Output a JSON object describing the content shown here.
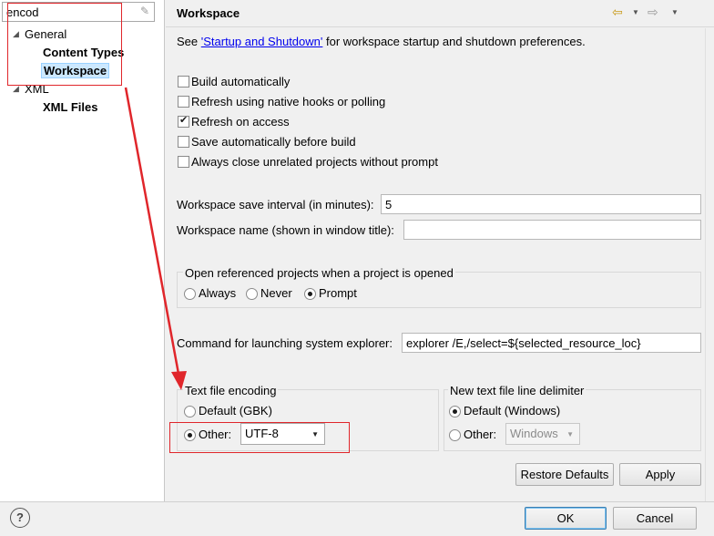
{
  "left_pane": {
    "filter_value": "encod",
    "clear_icon": "eraser-icon",
    "tree": [
      {
        "label": "General",
        "expanded": true,
        "arrow": "◢"
      },
      {
        "label": "Content Types"
      },
      {
        "label": "Workspace",
        "selected": true
      },
      {
        "label": "XML",
        "expanded": true,
        "arrow": "◢"
      },
      {
        "label": "XML Files"
      }
    ]
  },
  "header": {
    "title": "Workspace",
    "back_icon": "⇦",
    "menu_icon": "▼",
    "forward_icon": "⇨"
  },
  "intro": {
    "prefix": "See ",
    "link": "'Startup and Shutdown'",
    "suffix": " for workspace startup and shutdown preferences."
  },
  "checkboxes": [
    {
      "label": "Build automatically",
      "checked": false
    },
    {
      "label": "Refresh using native hooks or polling",
      "checked": false
    },
    {
      "label": "Refresh on access",
      "checked": true
    },
    {
      "label": "Save automatically before build",
      "checked": false
    },
    {
      "label": "Always close unrelated projects without prompt",
      "checked": false
    }
  ],
  "fields": {
    "save_interval_label": "Workspace save interval (in minutes):",
    "save_interval_value": "5",
    "workspace_name_label": "Workspace name (shown in window title):",
    "workspace_name_value": "",
    "explorer_label": "Command for launching system explorer:",
    "explorer_value": "explorer /E,/select=${selected_resource_loc}"
  },
  "open_referenced": {
    "title": "Open referenced projects when a project is opened",
    "options": [
      "Always",
      "Never",
      "Prompt"
    ],
    "selected": "Prompt"
  },
  "text_encoding": {
    "title": "Text file encoding",
    "default_label": "Default (GBK)",
    "other_label": "Other:",
    "selected": "Other",
    "other_value": "UTF-8"
  },
  "line_delimiter": {
    "title": "New text file line delimiter",
    "default_label": "Default (Windows)",
    "other_label": "Other:",
    "selected": "Default",
    "other_value": "Windows"
  },
  "buttons": {
    "restore_defaults": "Restore Defaults",
    "apply": "Apply",
    "ok": "OK",
    "cancel": "Cancel",
    "help": "?"
  },
  "colors": {
    "annotation": "#e0262b",
    "link": "#0000ee",
    "selection": "#cce8ff"
  }
}
